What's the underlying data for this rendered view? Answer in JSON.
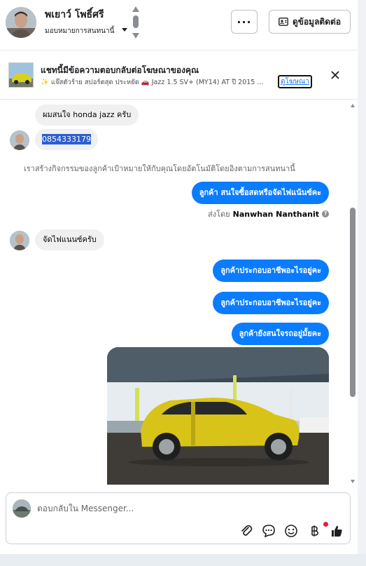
{
  "header": {
    "contact_name": "พเยาว์ โพธิ์ศรี",
    "assign_label": "มอบหมายการสนทนานี้",
    "more_label": "···",
    "contact_info_label": "ดูข้อมูลติดต่อ"
  },
  "ad_banner": {
    "title": "แชทนี้มีข้อความตอบกลับต่อโฆษณาของคุณ",
    "subtitle": "✨ แจ๊สตัวร้าย สปอร์ตสุด ประหยัด 🚗 Jazz 1.5 SV+ (MY14) AT ปี 2015 ...",
    "link_label": "ดูโฆษณา"
  },
  "messages": {
    "m1": "ผมสนใจ honda jazz ครับ",
    "m2_phone": "0854333179",
    "system": "เราสร้างกิจกรรมของลูกค้าเป้าหมายให้กับคุณโดยอัตโนมัติโดยอิงตามการสนทนานี้",
    "m3": "ลูกค้า  สนใจซื้อสดหรือจัดไฟแน้นซ์คะ",
    "sent_by_prefix": "ส่งโดย",
    "sent_by_name": "Nanwhan Nanthanit",
    "m4": "จัดไฟแนนซ์ครับ",
    "m5": "ลูกค้าประกอบอาชีพอะไรอยู่คะ",
    "m6": "ลูกค้าประกอบอาชีพอะไรอยู่คะ",
    "m7": "ลูกค้ายังสนใจรถอยู่มั้ยคะ"
  },
  "composer": {
    "placeholder": "ตอบกลับใน Messenger..."
  },
  "colors": {
    "accent": "#0a7cff",
    "incoming_bubble": "#f0f0f0",
    "notification_dot": "#e41e3f"
  },
  "icons": [
    "caret-down-icon",
    "stepper-icon",
    "contact-card-icon",
    "close-icon",
    "attachment-icon",
    "saved-reply-icon",
    "emoji-icon",
    "payment-icon",
    "thumbs-up-icon",
    "info-icon"
  ]
}
